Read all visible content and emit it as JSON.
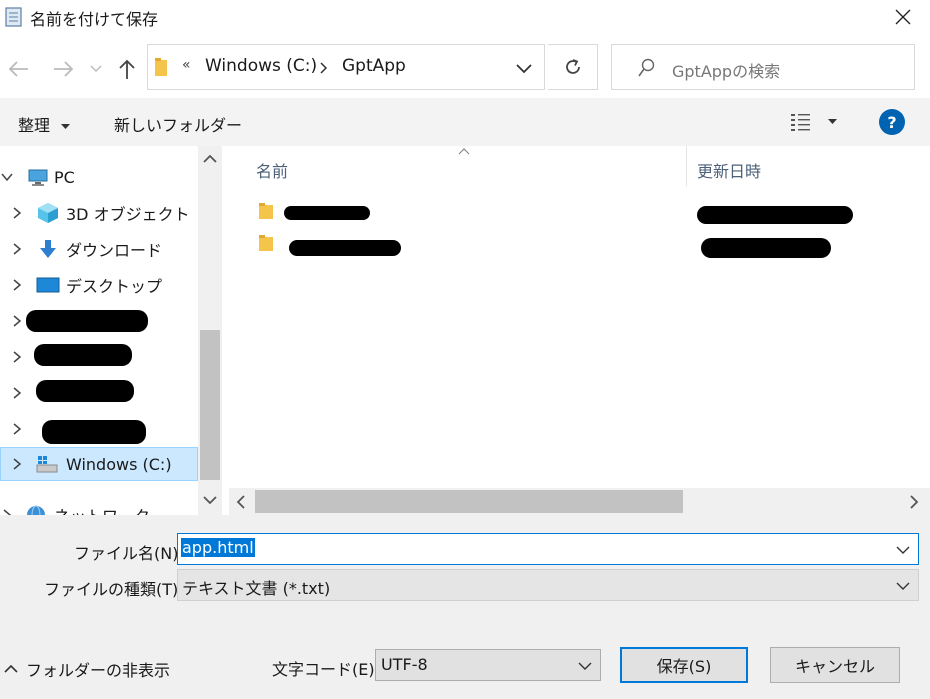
{
  "window": {
    "title": "名前を付けて保存"
  },
  "address": {
    "overflow": "«",
    "segments": [
      "Windows (C:)",
      "GptApp"
    ]
  },
  "search": {
    "placeholder": "GptAppの検索"
  },
  "toolbar": {
    "organize_label": "整理",
    "new_folder_label": "新しいフォルダー"
  },
  "help": {
    "label": "?"
  },
  "nav_tree": {
    "items": [
      {
        "label": "PC",
        "icon": "pc-icon"
      },
      {
        "label": "3D オブジェクト",
        "icon": "3d-objects-icon"
      },
      {
        "label": "ダウンロード",
        "icon": "download-icon"
      },
      {
        "label": "デスクトップ",
        "icon": "desktop-icon"
      },
      {
        "label": "Windows (C:)",
        "icon": "drive-icon",
        "selected": true
      },
      {
        "label": "ネットワーク",
        "icon": "network-icon"
      }
    ]
  },
  "file_list": {
    "columns": {
      "name": "名前",
      "date": "更新日時"
    }
  },
  "form": {
    "filename_label": "ファイル名(N):",
    "filename_value": "app.html",
    "filetype_label": "ファイルの種類(T):",
    "filetype_value": "テキスト文書 (*.txt)",
    "encoding_label": "文字コード(E):",
    "encoding_value": "UTF-8"
  },
  "buttons": {
    "save": "保存(S)",
    "cancel": "キャンセル",
    "hide_folders": "フォルダーの非表示"
  },
  "colors": {
    "accent": "#0078d7",
    "selection": "#cce8ff",
    "help": "#0063b1"
  }
}
